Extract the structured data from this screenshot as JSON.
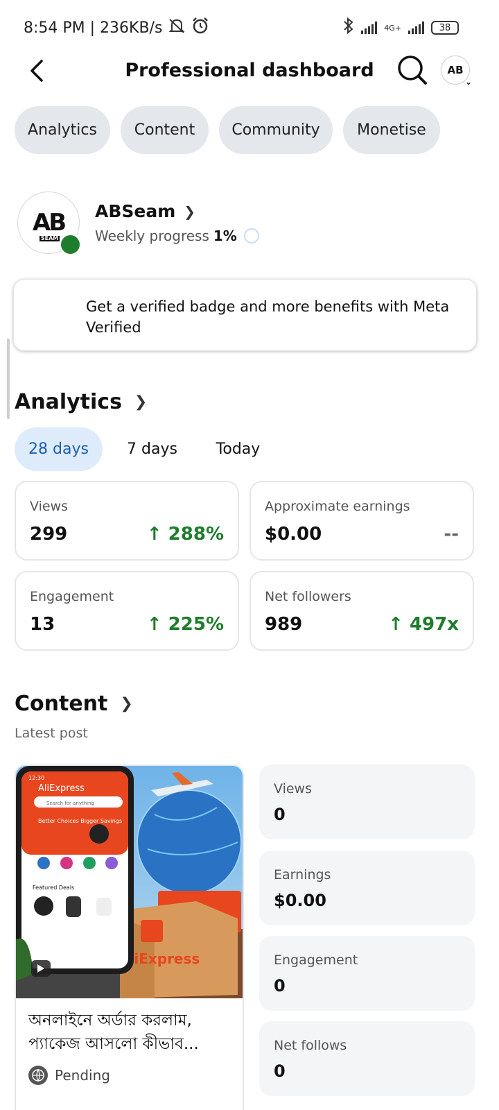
{
  "status_bar": {
    "time_speed": "8:54 PM | 236KB/s",
    "network": "4G+",
    "battery": "38"
  },
  "header": {
    "title": "Professional dashboard",
    "avatar_text": "AB"
  },
  "tabs": [
    "Analytics",
    "Content",
    "Community",
    "Monetise"
  ],
  "profile": {
    "name": "ABSeam",
    "weekly_label": "Weekly progress",
    "weekly_value": "1%",
    "logo_text": "AB",
    "logo_sub": "SEAM"
  },
  "banner": {
    "text": "Get a verified badge and more benefits with Meta Verified"
  },
  "analytics": {
    "title": "Analytics",
    "periods": [
      "28 days",
      "7 days",
      "Today"
    ],
    "active_period": "28 days",
    "cards": [
      {
        "label": "Views",
        "value": "299",
        "delta": "↑ 288%"
      },
      {
        "label": "Approximate earnings",
        "value": "$0.00",
        "delta": "--"
      },
      {
        "label": "Engagement",
        "value": "13",
        "delta": "↑ 225%"
      },
      {
        "label": "Net followers",
        "value": "989",
        "delta": "↑ 497x"
      }
    ]
  },
  "content": {
    "title": "Content",
    "latest_label": "Latest post",
    "post": {
      "title": "অনলাইনে অর্ডার করলাম, প্যাকেজ আসলো কীভাব...",
      "status": "Pending",
      "thumb_brand": "AliExpress",
      "thumb_search": "Search for anything",
      "thumb_promo": "Better Choices Bigger Savings",
      "thumb_deals": "Featured Deals",
      "thumb_time": "12:30"
    },
    "stats": [
      {
        "label": "Views",
        "value": "0"
      },
      {
        "label": "Earnings",
        "value": "$0.00"
      },
      {
        "label": "Engagement",
        "value": "0"
      },
      {
        "label": "Net follows",
        "value": "0"
      }
    ]
  },
  "colors": {
    "positive": "#1e7d2c",
    "chip_bg": "#e4e7eb",
    "active_period_bg": "#deebfb",
    "active_period_text": "#1a5fb4",
    "brand_orange": "#e8461e"
  }
}
